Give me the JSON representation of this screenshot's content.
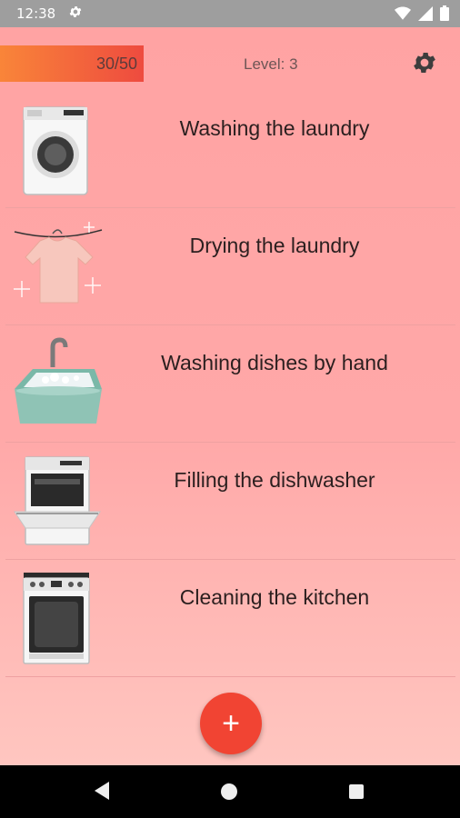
{
  "status_bar": {
    "time": "12:38",
    "icons": [
      "settings-icon",
      "wifi-icon",
      "signal-icon",
      "battery-icon"
    ]
  },
  "header": {
    "progress_text": "30/50",
    "progress_value": 0.6,
    "level_text": "Level: 3",
    "settings_icon": "gear-icon"
  },
  "tasks": [
    {
      "label": "Washing the laundry",
      "icon": "washing-machine-icon"
    },
    {
      "label": "Drying the laundry",
      "icon": "shirt-on-line-icon"
    },
    {
      "label": "Washing dishes by hand",
      "icon": "sink-icon"
    },
    {
      "label": "Filling the dishwasher",
      "icon": "dishwasher-icon"
    },
    {
      "label": "Cleaning the kitchen",
      "icon": "stove-icon"
    }
  ],
  "fab": {
    "label": "+",
    "icon": "add-icon"
  },
  "nav": {
    "icons": [
      "back-icon",
      "home-icon",
      "recents-icon"
    ]
  },
  "colors": {
    "progress_start": "#f98539",
    "progress_end": "#ee4b3f",
    "fab": "#f14433",
    "background": "#ffa3a3"
  }
}
